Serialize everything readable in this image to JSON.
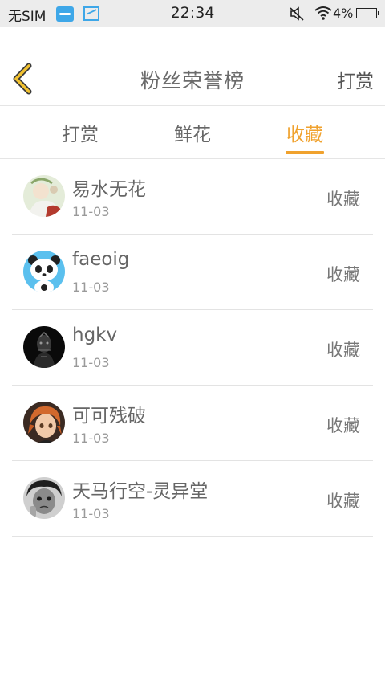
{
  "status_bar": {
    "carrier": "无SIM",
    "time": "22:34",
    "battery": "4%"
  },
  "header": {
    "title": "粉丝荣誉榜",
    "action": "打赏"
  },
  "tabs": [
    {
      "label": "打赏",
      "active": false
    },
    {
      "label": "鲜花",
      "active": false
    },
    {
      "label": "收藏",
      "active": true
    }
  ],
  "accent_color": "#f0a22e",
  "fans": [
    {
      "name": "易水无花",
      "date": "11-03",
      "action": "收藏"
    },
    {
      "name": "faeoig",
      "date": "11-03",
      "action": "收藏"
    },
    {
      "name": "hgkv",
      "date": "11-03",
      "action": "收藏"
    },
    {
      "name": "可可残破",
      "date": "11-03",
      "action": "收藏"
    },
    {
      "name": "天马行空-灵异堂",
      "date": "11-03",
      "action": "收藏"
    }
  ]
}
